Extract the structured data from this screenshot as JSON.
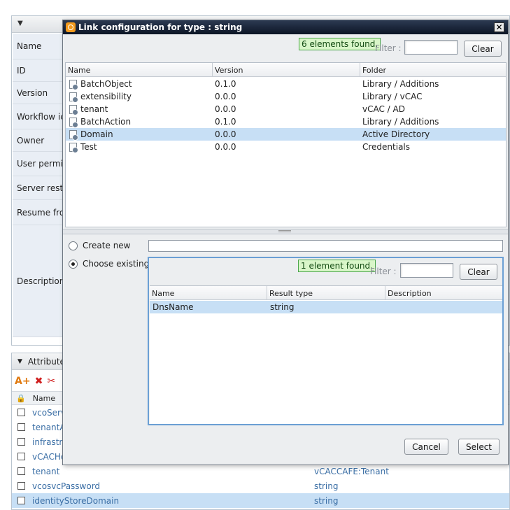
{
  "background": {
    "form_labels": [
      "Name",
      "ID",
      "Version",
      "Workflow ico",
      "Owner",
      "User permis",
      "Server resta",
      "Resume fro",
      "Description"
    ],
    "attributes_panel": {
      "title": "Attribute",
      "col_name": "Name",
      "rows": [
        {
          "name": "vcoServ",
          "type": ""
        },
        {
          "name": "tenantA",
          "type": ""
        },
        {
          "name": "infrastru",
          "type": ""
        },
        {
          "name": "vCACHo",
          "type": ""
        },
        {
          "name": "tenant",
          "type": "vCACCAFE:Tenant"
        },
        {
          "name": "vcosvcPassword",
          "type": "string"
        },
        {
          "name": "identityStoreDomain",
          "type": "string",
          "selected": true
        }
      ]
    }
  },
  "dialog": {
    "title": "Link configuration for type : string",
    "top_search": {
      "found_text": "6 elements found.",
      "filter_label": "Filter :",
      "filter_value": "",
      "clear_label": "Clear"
    },
    "top_table": {
      "columns": [
        "Name",
        "Version",
        "Folder"
      ],
      "rows": [
        {
          "name": "BatchObject",
          "version": "0.1.0",
          "folder": "Library / Additions"
        },
        {
          "name": "extensibility",
          "version": "0.0.0",
          "folder": "Library / vCAC"
        },
        {
          "name": "tenant",
          "version": "0.0.0",
          "folder": "vCAC / AD"
        },
        {
          "name": "BatchAction",
          "version": "0.1.0",
          "folder": "Library / Additions"
        },
        {
          "name": "Domain",
          "version": "0.0.0",
          "folder": "Active Directory",
          "selected": true
        },
        {
          "name": "Test",
          "version": "0.0.0",
          "folder": "Credentials"
        }
      ]
    },
    "create_new_label": "Create new",
    "create_new_value": "",
    "choose_existing_label": "Choose existing",
    "bottom_search": {
      "found_text": "1 element found.",
      "filter_label": "Filter :",
      "filter_value": "",
      "clear_label": "Clear"
    },
    "bottom_table": {
      "columns": [
        "Name",
        "Result type",
        "Description"
      ],
      "rows": [
        {
          "name": "DnsName",
          "result_type": "string",
          "description": "",
          "selected": true
        }
      ]
    },
    "cancel_label": "Cancel",
    "select_label": "Select"
  },
  "colors": {
    "selection": "#c7dff5",
    "badge_bg": "#d9f6c9",
    "titlebar": "#0c1525",
    "accent": "#6b9fd4"
  }
}
